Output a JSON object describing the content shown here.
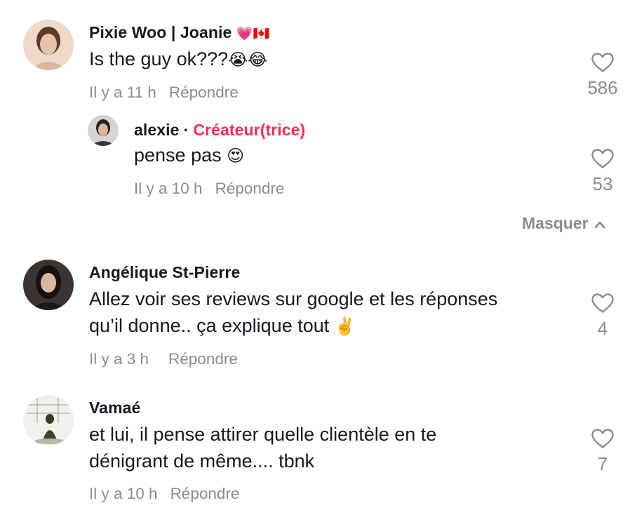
{
  "comments": [
    {
      "author": "Pixie Woo | Joanie",
      "author_emojis": "💗🇨🇦",
      "text": "Is the guy ok???",
      "text_emojis": "😭😂",
      "time": "Il y a 11 h",
      "reply_label": "Répondre",
      "likes": "586",
      "replies": [
        {
          "author": "alexie",
          "separator": "·",
          "badge": "Créateur(trice)",
          "text": "pense pas",
          "text_emoji": "😍",
          "time": "Il y a 10 h",
          "reply_label": "Répondre",
          "likes": "53"
        }
      ],
      "hide_label": "Masquer"
    },
    {
      "author": "Angélique St-Pierre",
      "text_line1": "Allez voir ses reviews sur google et les réponses",
      "text_line2": "qu’il donne.. ça explique tout",
      "text_emoji": "✌️",
      "time": "Il y a 3 h",
      "reply_label": "Répondre",
      "likes": "4"
    },
    {
      "author": "Vamaé",
      "text_line1": "et lui, il pense attirer quelle clientèle en te",
      "text_line2": "dénigrant de même.... tbnk",
      "time": "Il y a 10 h",
      "reply_label": "Répondre",
      "likes": "7"
    }
  ],
  "icons": {
    "like": "heart-outline-icon",
    "collapse": "chevron-up-icon"
  },
  "colors": {
    "creator_badge": "#fe2c55",
    "muted": "#8a8b91"
  }
}
